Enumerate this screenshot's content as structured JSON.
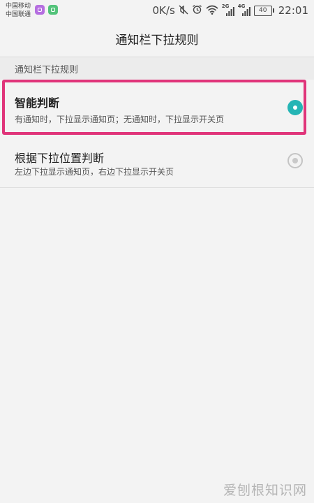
{
  "status_bar": {
    "carrier_1": "中国移动",
    "carrier_2": "中国联通",
    "speed": "0K/s",
    "signal_1_tag": "2G",
    "signal_2_tag": "4G",
    "battery": "40",
    "time": "22:01",
    "icons": [
      "mute-icon",
      "alarm-icon",
      "wifi-icon"
    ]
  },
  "header": {
    "title": "通知栏下拉规则"
  },
  "section": {
    "title": "通知栏下拉规则"
  },
  "options": [
    {
      "title": "智能判断",
      "subtitle": "有通知时，下拉显示通知页；无通知时，下拉显示开关页",
      "selected": true
    },
    {
      "title": "根据下拉位置判断",
      "subtitle": "左边下拉显示通知页，右边下拉显示开关页",
      "selected": false
    }
  ],
  "watermark": "爱刨根知识网",
  "colors": {
    "accent": "#25b5b5",
    "highlight": "#e0357a"
  }
}
